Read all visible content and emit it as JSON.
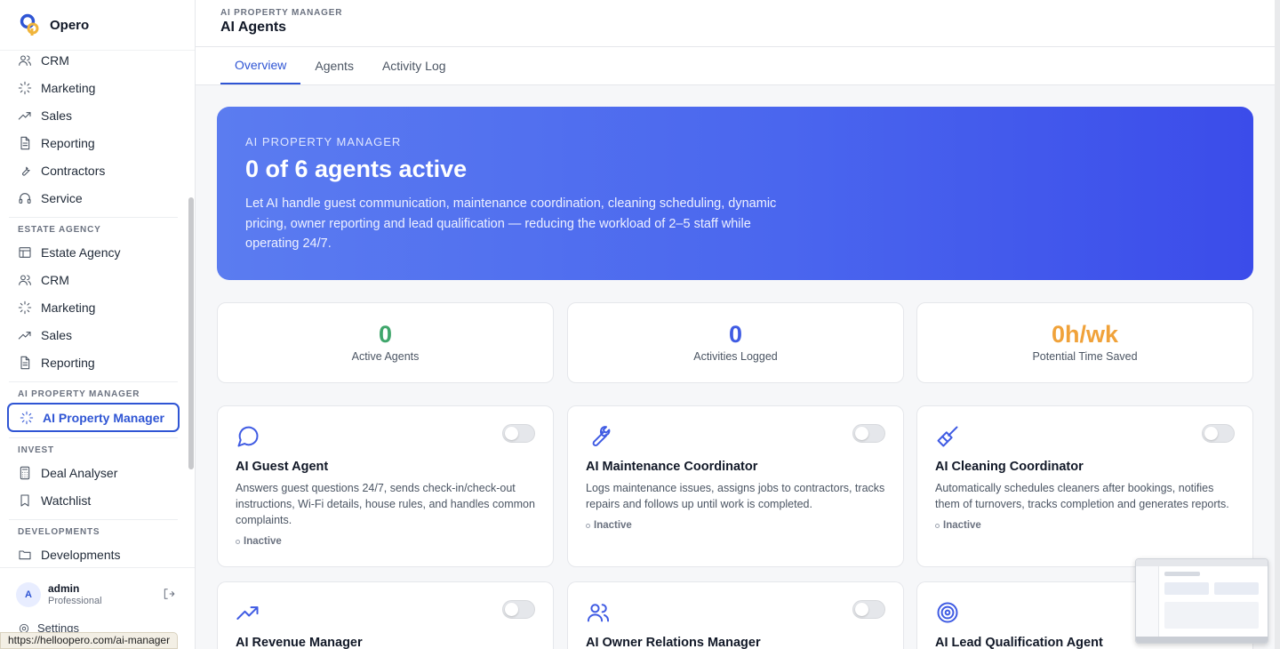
{
  "brand": {
    "name": "Opero"
  },
  "sidebar": {
    "group1": [
      {
        "label": "CRM",
        "icon": "users-icon"
      },
      {
        "label": "Marketing",
        "icon": "sparkle-icon"
      },
      {
        "label": "Sales",
        "icon": "trend-up-icon"
      },
      {
        "label": "Reporting",
        "icon": "document-icon"
      },
      {
        "label": "Contractors",
        "icon": "wrench-icon"
      },
      {
        "label": "Service",
        "icon": "headset-icon"
      }
    ],
    "sections": {
      "estate": "ESTATE AGENCY",
      "aipm": "AI PROPERTY MANAGER",
      "invest": "INVEST",
      "dev": "DEVELOPMENTS"
    },
    "estate_items": [
      {
        "label": "Estate Agency",
        "icon": "table-icon"
      },
      {
        "label": "CRM",
        "icon": "users-icon"
      },
      {
        "label": "Marketing",
        "icon": "sparkle-icon"
      },
      {
        "label": "Sales",
        "icon": "trend-up-icon"
      },
      {
        "label": "Reporting",
        "icon": "document-icon"
      }
    ],
    "aipm_item": {
      "label": "AI Property Manager"
    },
    "invest_items": [
      {
        "label": "Deal Analyser",
        "icon": "calculator-icon"
      },
      {
        "label": "Watchlist",
        "icon": "bookmark-icon"
      }
    ],
    "dev_item": {
      "label": "Developments"
    },
    "user": {
      "initial": "A",
      "name": "admin",
      "plan": "Professional"
    },
    "settings_label": "Settings"
  },
  "status_url": "https://helloopero.com/ai-manager",
  "header": {
    "kicker": "AI PROPERTY MANAGER",
    "title": "AI Agents"
  },
  "tabs": [
    "Overview",
    "Agents",
    "Activity Log"
  ],
  "hero": {
    "kicker": "AI PROPERTY MANAGER",
    "headline": "0 of 6 agents active",
    "description": "Let AI handle guest communication, maintenance coordination, cleaning scheduling, dynamic pricing, owner reporting and lead qualification — reducing the workload of 2–5 staff while operating 24/7."
  },
  "stats": [
    {
      "value": "0",
      "label": "Active Agents",
      "color": "#3fa66b"
    },
    {
      "value": "0",
      "label": "Activities Logged",
      "color": "#3f5be3"
    },
    {
      "value": "0h/wk",
      "label": "Potential Time Saved",
      "color": "#f0a23a"
    }
  ],
  "agents": [
    {
      "title": "AI Guest Agent",
      "description": "Answers guest questions 24/7, sends check-in/check-out instructions, Wi-Fi details, house rules, and handles common complaints.",
      "status": "Inactive",
      "icon": "chat-bubble-icon",
      "enabled": false
    },
    {
      "title": "AI Maintenance Coordinator",
      "description": "Logs maintenance issues, assigns jobs to contractors, tracks repairs and follows up until work is completed.",
      "status": "Inactive",
      "icon": "wrench-icon",
      "enabled": false
    },
    {
      "title": "AI Cleaning Coordinator",
      "description": "Automatically schedules cleaners after bookings, notifies them of turnovers, tracks completion and generates reports.",
      "status": "Inactive",
      "icon": "broom-icon",
      "enabled": false
    },
    {
      "title": "AI Revenue Manager",
      "icon": "trend-up-icon",
      "enabled": false
    },
    {
      "title": "AI Owner Relations Manager",
      "icon": "users-icon",
      "enabled": false
    },
    {
      "title": "AI Lead Qualification Agent",
      "icon": "target-icon",
      "enabled": false
    }
  ]
}
